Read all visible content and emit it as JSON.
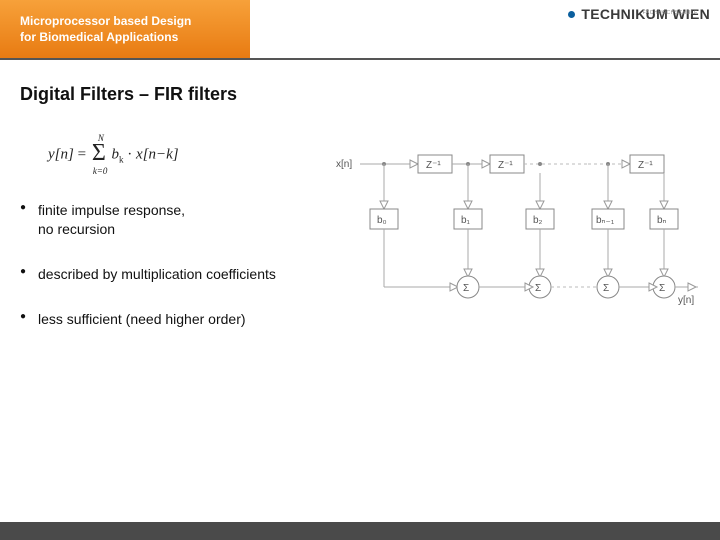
{
  "header": {
    "title_line1": "Microprocessor based Design",
    "title_line2": "for Biomedical Applications",
    "logo_text": "TECHNIKUM WIEN",
    "logo_overline": "FACHHOCHSCHULE"
  },
  "slide": {
    "title": "Digital Filters – FIR filters"
  },
  "formula": {
    "lhs": "y[n]",
    "eq": "=",
    "sigma": "Σ",
    "sum_upper": "N",
    "sum_lower": "k=0",
    "term1": "b",
    "term1_sub": "k",
    "dot": "·",
    "term2": "x[n−k]"
  },
  "bullets": [
    "finite impulse response,\nno recursion",
    "described by multiplication coefficients",
    "less sufficient (need higher order)"
  ],
  "diagram": {
    "input": "x[n]",
    "delay": "Z⁻¹",
    "coeffs": [
      "b₀",
      "b₁",
      "b₂",
      "bₙ₋₁",
      "bₙ"
    ],
    "sum": "Σ",
    "output": "y[n]"
  }
}
